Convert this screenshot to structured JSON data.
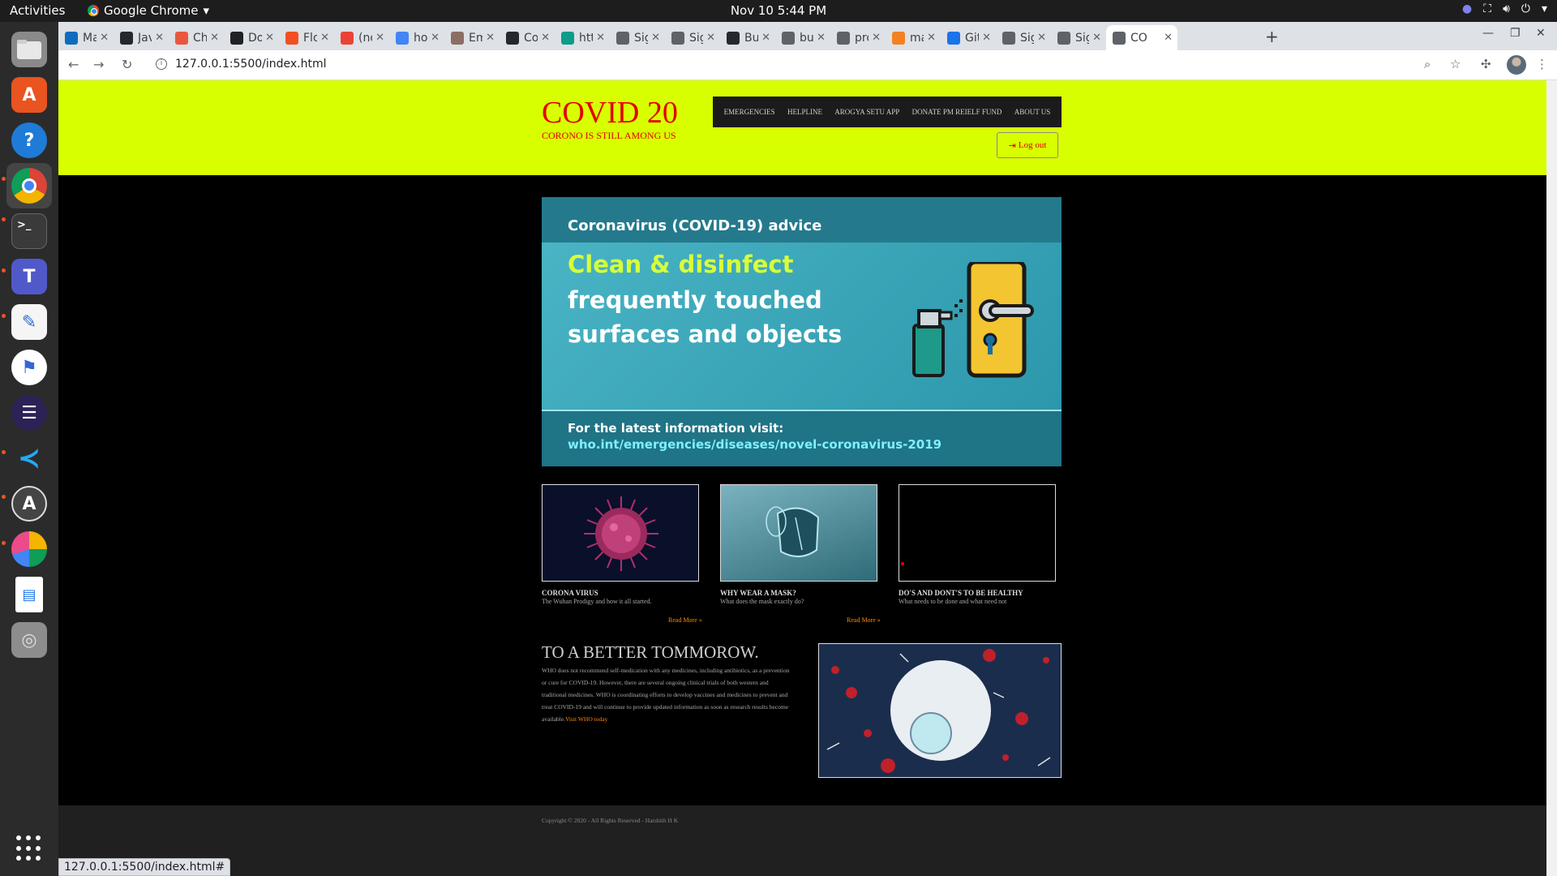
{
  "desktop": {
    "activities_label": "Activities",
    "app_name": "Google Chrome",
    "clock": "Nov 10  5:44 PM"
  },
  "dock": {
    "items": [
      {
        "name": "files",
        "icon": "folder-icon"
      },
      {
        "name": "software",
        "icon": "app-store-icon"
      },
      {
        "name": "help",
        "icon": "help-icon"
      },
      {
        "name": "chrome",
        "icon": "chrome-icon"
      },
      {
        "name": "terminal",
        "icon": "terminal-icon"
      },
      {
        "name": "teams",
        "icon": "teams-icon"
      },
      {
        "name": "text-editor",
        "icon": "text-editor-icon"
      },
      {
        "name": "android-studio",
        "icon": "android-studio-icon"
      },
      {
        "name": "eclipse",
        "icon": "eclipse-icon"
      },
      {
        "name": "vscode",
        "icon": "vscode-icon"
      },
      {
        "name": "software-updater",
        "icon": "updater-icon"
      },
      {
        "name": "disk-usage",
        "icon": "pie-chart-icon"
      },
      {
        "name": "writer",
        "icon": "document-icon"
      },
      {
        "name": "optical-drive",
        "icon": "disc-icon"
      }
    ]
  },
  "browser": {
    "tabs": [
      {
        "title": "Ma",
        "favicon_color": "#0f6cbd"
      },
      {
        "title": "Jav",
        "favicon_color": "#24292f"
      },
      {
        "title": "Ch",
        "favicon_color": "#e9573f"
      },
      {
        "title": "Do",
        "favicon_color": "#202124"
      },
      {
        "title": "Flo",
        "favicon_color": "#f25022"
      },
      {
        "title": "(no",
        "favicon_color": "#ea4335"
      },
      {
        "title": "ho",
        "favicon_color": "#4285f4"
      },
      {
        "title": "Em",
        "favicon_color": "#8d6e63"
      },
      {
        "title": "Co",
        "favicon_color": "#24292f"
      },
      {
        "title": "htt",
        "favicon_color": "#0f9d8a"
      },
      {
        "title": "Sig",
        "favicon_color": "#5f6368"
      },
      {
        "title": "Sig",
        "favicon_color": "#5f6368"
      },
      {
        "title": "Bu",
        "favicon_color": "#24292f"
      },
      {
        "title": "bu",
        "favicon_color": "#5f6368"
      },
      {
        "title": "projec",
        "favicon_color": "#5f6368"
      },
      {
        "title": "macos",
        "favicon_color": "#f48024"
      },
      {
        "title": "Git Me",
        "favicon_color": "#1a73e8"
      },
      {
        "title": "Sign U",
        "favicon_color": "#5f6368"
      },
      {
        "title": "Sign U",
        "favicon_color": "#5f6368"
      },
      {
        "title": "CO",
        "favicon_color": "#5f6368",
        "active": true
      }
    ],
    "url": "127.0.0.1:5500/index.html",
    "status_url": "127.0.0.1:5500/index.html#"
  },
  "site": {
    "title": "COVID 20",
    "subtitle": "CORONO IS STILL AMONG US",
    "nav": [
      "EMERGENCIES",
      "HELPLINE",
      "AROGYA SETU APP",
      "DONATE PM REIELF FUND",
      "ABOUT US"
    ],
    "logout_label": "Log out",
    "banner": {
      "heading": "Coronavirus (COVID-19) advice",
      "line1": "Clean & disinfect",
      "line2": "frequently touched",
      "line3": "surfaces and objects",
      "footer1": "For the latest information visit:",
      "footer2": "who.int/emergencies/diseases/novel-coronavirus-2019"
    },
    "cards": [
      {
        "title": "CORONA VIRUS",
        "desc": "The Wuhan Prodigy and how it all started.",
        "readmore": "Read More »"
      },
      {
        "title": "WHY WEAR A MASK?",
        "desc": "What does the mask exactly do?",
        "readmore": "Read More »"
      },
      {
        "title": "DO'S AND DONT'S TO BE HEALTHY",
        "desc": "What needs to be done and what need not"
      }
    ],
    "better": {
      "title": "TO A BETTER TOMMOROW.",
      "text": "WHO does not recommend self-medication with any medicines, including antibiotics, as a prevention or cure for COVID-19. However, there are several ongoing clinical trials of both western and traditional medicines. WHO is coordinating efforts to develop vaccines and medicines to prevent and treat COVID-19 and will continue to provide updated information as soon as research results become available.",
      "link": "Visit WHO today"
    },
    "footer": "Copyright © 2020 - All Rights Reserved - Harshith H K",
    "colors": {
      "header_bg": "#d8ff00",
      "title_red": "#e00000",
      "link_orange": "#ff8a00"
    }
  }
}
